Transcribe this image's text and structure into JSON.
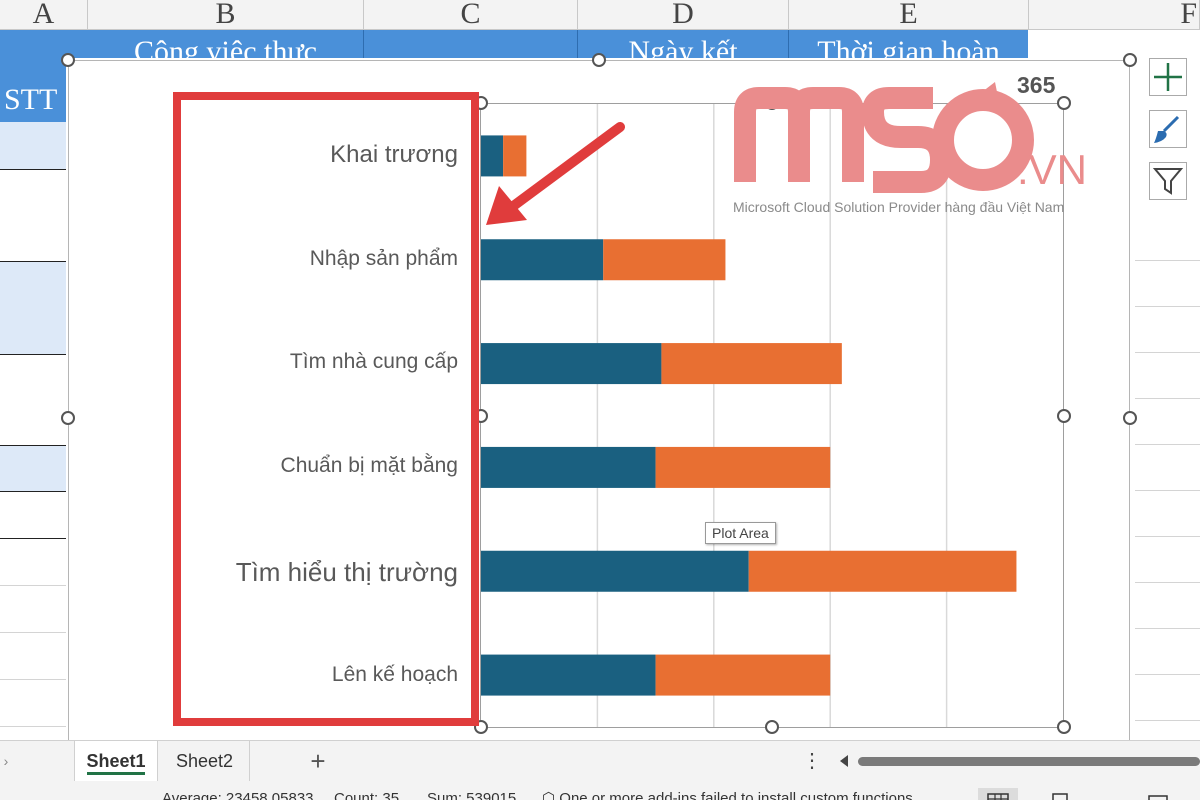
{
  "columns": [
    "A",
    "B",
    "C",
    "D",
    "E",
    "F"
  ],
  "header_row": {
    "stt": "STT",
    "task": "Công việc thực",
    "end_date": "Ngày kết",
    "duration": "Thời gian hoàn"
  },
  "chart": {
    "tooltip": "Plot Area",
    "colors": {
      "start": "#1a6080",
      "duration": "#e86f32",
      "highlight": "#e03c3c",
      "accent": "#4a90d9"
    }
  },
  "chart_data": {
    "type": "bar",
    "orientation": "horizontal",
    "stacked": true,
    "categories": [
      "Khai trương",
      "Nhập sản phẩm",
      "Tìm nhà cung cấp",
      "Chuẩn bị mặt bằng",
      "Tìm hiểu thị trường",
      "Lên kế hoạch"
    ],
    "series": [
      {
        "values": [
          0.19,
          1.05,
          1.55,
          1.5,
          2.3,
          1.5
        ],
        "color": "#1a6080"
      },
      {
        "values": [
          0.2,
          1.05,
          1.55,
          1.5,
          2.3,
          1.5
        ],
        "color": "#e86f32"
      }
    ],
    "xlim": [
      0,
      5
    ],
    "gridlines": true,
    "legend": "none"
  },
  "watermark": {
    "brand": "MSO",
    "domain": ".VN",
    "badge": "365",
    "tagline": "Microsoft Cloud Solution Provider hàng đầu Việt Nam"
  },
  "tabs": {
    "sheet1": "Sheet1",
    "sheet2": "Sheet2",
    "add": "+",
    "more": "⋮"
  },
  "status": {
    "average": "Average: 23458.05833",
    "count": "Count: 35",
    "sum": "Sum: 539015",
    "message": "One or more add-ins failed to install custom functions"
  }
}
